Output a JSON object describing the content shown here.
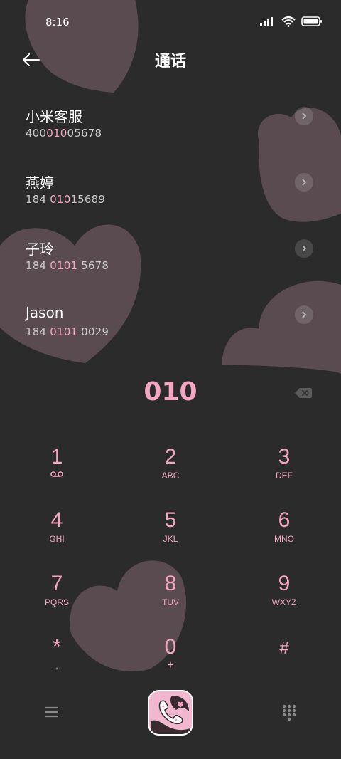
{
  "status_bar": {
    "time": "8:16",
    "icons": [
      "signal-icon",
      "wifi-icon",
      "battery-icon"
    ]
  },
  "header": {
    "title": "通话",
    "back_icon": "back-arrow-icon"
  },
  "contacts": [
    {
      "name": "小米客服",
      "number_pre": "400",
      "number_hl": "010",
      "number_post": "05678"
    },
    {
      "name": "燕婷",
      "number_pre": "184 ",
      "number_hl": "010",
      "number_post": "15689"
    },
    {
      "name": "子玲",
      "number_pre": "184 ",
      "number_hl": "0101",
      "number_post": " 5678"
    },
    {
      "name": "Jason",
      "number_pre": "184 ",
      "number_hl": "0101",
      "number_post": " 0029"
    }
  ],
  "dialer": {
    "number": "010"
  },
  "keypad": [
    {
      "digit": "1",
      "letters": ""
    },
    {
      "digit": "2",
      "letters": "ABC"
    },
    {
      "digit": "3",
      "letters": "DEF"
    },
    {
      "digit": "4",
      "letters": "GHI"
    },
    {
      "digit": "5",
      "letters": "JKL"
    },
    {
      "digit": "6",
      "letters": "MNO"
    },
    {
      "digit": "7",
      "letters": "PQRS"
    },
    {
      "digit": "8",
      "letters": "TUV"
    },
    {
      "digit": "9",
      "letters": "WXYZ"
    },
    {
      "digit": "*",
      "letters": ","
    },
    {
      "digit": "0",
      "letters": "+"
    },
    {
      "digit": "#",
      "letters": ""
    }
  ],
  "bottom_bar": {
    "icons": [
      "menu-icon",
      "call-icon",
      "dialpad-icon"
    ]
  },
  "colors": {
    "background": "#2b2b2b",
    "accent": "#f4a6c3",
    "heart": "#5a4b50"
  }
}
